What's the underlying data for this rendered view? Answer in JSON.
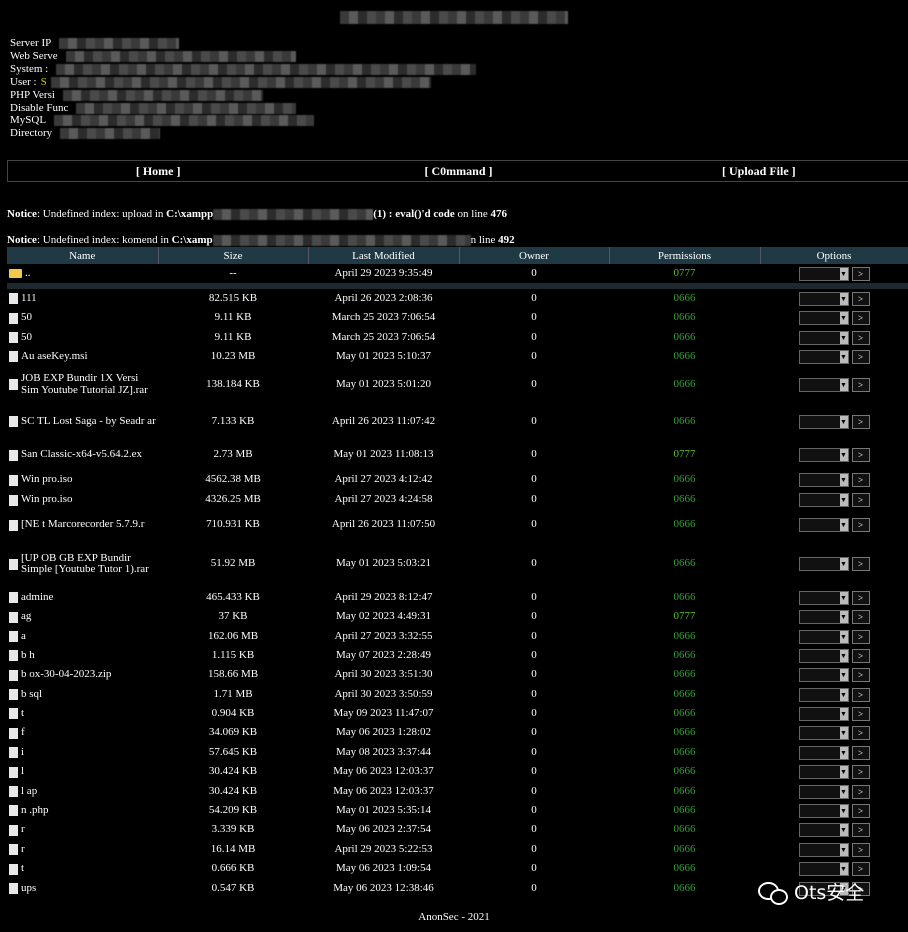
{
  "info": [
    {
      "label": "Server IP",
      "value": ""
    },
    {
      "label": "Web Serve",
      "value": ""
    },
    {
      "label": "System :",
      "value": ""
    },
    {
      "label": "User :",
      "value": "S"
    },
    {
      "label": "PHP Versi",
      "value": ""
    },
    {
      "label": "Disable Func",
      "value": ""
    },
    {
      "label": "MySQL",
      "value": ""
    },
    {
      "label": "Directory",
      "value": ""
    }
  ],
  "nav": {
    "home": "[ Home ]",
    "command": "[ C0mmand ]",
    "upload": "[ Upload File ]"
  },
  "notices": [
    {
      "prefix": "Notice",
      "text": ": Undefined index: upload in ",
      "path": "C:\\xampp",
      "tail": "(1) : eval()'d code",
      "on": " on line ",
      "line": "476"
    },
    {
      "prefix": "Notice",
      "text": ": Undefined index: komend in ",
      "path": "C:\\xamp",
      "tail": "",
      "on": "n line ",
      "line": "492"
    }
  ],
  "table": {
    "headers": [
      "Name",
      "Size",
      "Last Modified",
      "Owner",
      "Permissions",
      "Options"
    ],
    "parent": {
      "name": "..",
      "size": "--",
      "modified": "April 29 2023 9:35:49",
      "owner": "0",
      "perm": "0777"
    },
    "rows": [
      {
        "name": "111",
        "size": "82.515 KB",
        "modified": "April 26 2023 2:08:36",
        "owner": "0",
        "perm": "0666"
      },
      {
        "name": "50",
        "size": "9.11 KB",
        "modified": "March 25 2023 7:06:54",
        "owner": "0",
        "perm": "0666"
      },
      {
        "name": "50",
        "size": "9.11 KB",
        "modified": "March 25 2023 7:06:54",
        "owner": "0",
        "perm": "0666"
      },
      {
        "name": "Au         aseKey.msi",
        "size": "10.23 MB",
        "modified": "May 01 2023 5:10:37",
        "owner": "0",
        "perm": "0666"
      },
      {
        "name": "JOB      EXP Bundir 1X Versi Sim     Youtube Tutorial JZ].rar",
        "size": "138.184 KB",
        "modified": "May 01 2023 5:01:20",
        "owner": "0",
        "perm": "0666"
      },
      {
        "name": "SC        TL Lost Saga - by Seadr         ar",
        "size": "7.133 KB",
        "modified": "April 26 2023 11:07:42",
        "owner": "0",
        "perm": "0666"
      },
      {
        "name": "San        Classic-x64-v5.64.2.ex",
        "size": "2.73 MB",
        "modified": "May 01 2023 11:08:13",
        "owner": "0",
        "perm": "0777"
      },
      {
        "name": "Win          pro.iso",
        "size": "4562.38 MB",
        "modified": "April 27 2023 4:12:42",
        "owner": "0",
        "perm": "0666"
      },
      {
        "name": "Win          pro.iso",
        "size": "4326.25 MB",
        "modified": "April 27 2023 4:24:58",
        "owner": "0",
        "perm": "0666"
      },
      {
        "name": "[NE       t Marcorecorder 5.7.9.r",
        "size": "710.931 KB",
        "modified": "April 26 2023 11:07:50",
        "owner": "0",
        "perm": "0666"
      },
      {
        "name": "[UP       OB GB EXP Bundir        Simple [Youtube Tutor        1).rar",
        "size": "51.92 MB",
        "modified": "May 01 2023 5:03:21",
        "owner": "0",
        "perm": "0666"
      },
      {
        "name": "admine",
        "size": "465.433 KB",
        "modified": "April 29 2023 8:12:47",
        "owner": "0",
        "perm": "0666"
      },
      {
        "name": "ag",
        "size": "37 KB",
        "modified": "May 02 2023 4:49:31",
        "owner": "0",
        "perm": "0777"
      },
      {
        "name": "a",
        "size": "162.06 MB",
        "modified": "April 27 2023 3:32:55",
        "owner": "0",
        "perm": "0666"
      },
      {
        "name": "b          h",
        "size": "1.115 KB",
        "modified": "May 07 2023 2:28:49",
        "owner": "0",
        "perm": "0666"
      },
      {
        "name": "b          ox-30-04-2023.zip",
        "size": "158.66 MB",
        "modified": "April 30 2023 3:51:30",
        "owner": "0",
        "perm": "0666"
      },
      {
        "name": "b          sql",
        "size": "1.71 MB",
        "modified": "April 30 2023 3:50:59",
        "owner": "0",
        "perm": "0666"
      },
      {
        "name": "t",
        "size": "0.904 KB",
        "modified": "May 09 2023 11:47:07",
        "owner": "0",
        "perm": "0666"
      },
      {
        "name": "f",
        "size": "34.069 KB",
        "modified": "May 06 2023 1:28:02",
        "owner": "0",
        "perm": "0666"
      },
      {
        "name": "i",
        "size": "57.645 KB",
        "modified": "May 08 2023 3:37:44",
        "owner": "0",
        "perm": "0666"
      },
      {
        "name": "l",
        "size": "30.424 KB",
        "modified": "May 06 2023 12:03:37",
        "owner": "0",
        "perm": "0666"
      },
      {
        "name": "l       ap",
        "size": "30.424 KB",
        "modified": "May 06 2023 12:03:37",
        "owner": "0",
        "perm": "0666"
      },
      {
        "name": "n        .php",
        "size": "54.209 KB",
        "modified": "May 01 2023 5:35:14",
        "owner": "0",
        "perm": "0666"
      },
      {
        "name": "r",
        "size": "3.339 KB",
        "modified": "May 06 2023 2:37:54",
        "owner": "0",
        "perm": "0666"
      },
      {
        "name": "r",
        "size": "16.14 MB",
        "modified": "April 29 2023 5:22:53",
        "owner": "0",
        "perm": "0666"
      },
      {
        "name": "t",
        "size": "0.666 KB",
        "modified": "May 06 2023 1:09:54",
        "owner": "0",
        "perm": "0666"
      },
      {
        "name": "ups",
        "size": "0.547 KB",
        "modified": "May 06 2023 12:38:46",
        "owner": "0",
        "perm": "0666"
      }
    ],
    "go_label": ">"
  },
  "footer": "AnonSec - 2021",
  "watermark": "Ots安全",
  "colors": {
    "header_bg": "#1f3a45",
    "perm_green": "#34a034",
    "perm_bright": "#5cbf2a",
    "user_yellow": "#c7cc00"
  }
}
